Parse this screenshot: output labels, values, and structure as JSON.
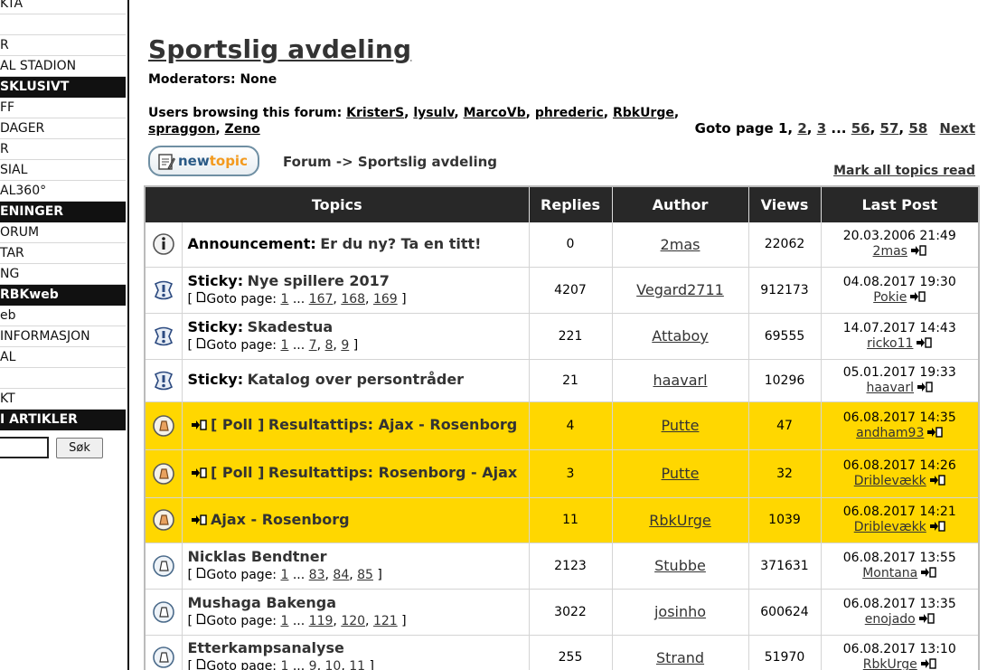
{
  "sidebar": {
    "items": [
      {
        "label": "KTA",
        "header": false
      },
      {
        "label": "",
        "header": false
      },
      {
        "label": "R",
        "header": false
      },
      {
        "label": "AL STADION",
        "header": false
      },
      {
        "label": "SKLUSIVT",
        "header": true
      },
      {
        "label": "FF",
        "header": false
      },
      {
        "label": "DAGER",
        "header": false
      },
      {
        "label": "R",
        "header": false
      },
      {
        "label": "SIAL",
        "header": false
      },
      {
        "label": "AL360°",
        "header": false
      },
      {
        "label": "ENINGER",
        "header": true
      },
      {
        "label": "ORUM",
        "header": false
      },
      {
        "label": "TAR",
        "header": false
      },
      {
        "label": "NG",
        "header": false
      },
      {
        "label": "RBKweb",
        "header": true
      },
      {
        "label": "eb",
        "header": false
      },
      {
        "label": " INFORMASJON",
        "header": false
      },
      {
        "label": "AL",
        "header": false
      },
      {
        "label": "",
        "header": false
      },
      {
        "label": "KT",
        "header": false
      },
      {
        "label": "I ARTIKLER",
        "header": true
      }
    ],
    "search_button": "Søk",
    "search_value": ""
  },
  "forum": {
    "title": "Sportslig avdeling",
    "moderators": "Moderators: None",
    "users_label": "Users browsing this forum:",
    "users": [
      "KristerS",
      "lysulv",
      "MarcoVb",
      "phrederic",
      "RbkUrge",
      "spraggon",
      "Zeno"
    ],
    "goto_label": "Goto page",
    "current_page": "1",
    "pages_start": [
      "2",
      "3"
    ],
    "ellipsis": "...",
    "pages_end": [
      "56",
      "57",
      "58"
    ],
    "next": "Next",
    "new_topic_a": "new",
    "new_topic_b": "topic",
    "breadcrumb_home": "Forum",
    "breadcrumb_sep": "->",
    "breadcrumb_current": "Sportslig avdeling",
    "mark_read": "Mark all topics read"
  },
  "table": {
    "headers": [
      "Topics",
      "Replies",
      "Author",
      "Views",
      "Last Post"
    ],
    "goto_page_label": "Goto page:",
    "rows": [
      {
        "type": "announcement",
        "kind": "Announcement:",
        "title": "Er du ny? Ta en titt!",
        "pages": null,
        "replies": "0",
        "author": "2mas",
        "views": "22062",
        "last_date": "20.03.2006 21:49",
        "last_user": "2mas",
        "hot": false
      },
      {
        "type": "sticky",
        "kind": "Sticky:",
        "title": "Nye spillere 2017",
        "pages": [
          "1",
          "167",
          "168",
          "169"
        ],
        "replies": "4207",
        "author": "Vegard2711",
        "views": "912173",
        "last_date": "04.08.2017 19:30",
        "last_user": "Pokie",
        "hot": false
      },
      {
        "type": "sticky",
        "kind": "Sticky:",
        "title": "Skadestua",
        "pages": [
          "1",
          "7",
          "8",
          "9"
        ],
        "replies": "221",
        "author": "Attaboy",
        "views": "69555",
        "last_date": "14.07.2017 14:43",
        "last_user": "ricko11",
        "hot": false
      },
      {
        "type": "sticky",
        "kind": "Sticky:",
        "title": "Katalog over persontråder",
        "pages": null,
        "replies": "21",
        "author": "haavarl",
        "views": "10296",
        "last_date": "05.01.2017 19:33",
        "last_user": "haavarl",
        "hot": false
      },
      {
        "type": "poll",
        "kind": "[ Poll ]",
        "title": "Resultattips: Ajax - Rosenborg",
        "pages": null,
        "replies": "4",
        "author": "Putte",
        "views": "47",
        "last_date": "06.08.2017 14:35",
        "last_user": "andham93",
        "hot": true
      },
      {
        "type": "poll",
        "kind": "[ Poll ]",
        "title": "Resultattips: Rosenborg - Ajax",
        "pages": null,
        "replies": "3",
        "author": "Putte",
        "views": "32",
        "last_date": "06.08.2017 14:26",
        "last_user": "Driblevækk",
        "hot": true
      },
      {
        "type": "new",
        "kind": "",
        "title": "Ajax - Rosenborg",
        "pages": null,
        "replies": "11",
        "author": "RbkUrge",
        "views": "1039",
        "last_date": "06.08.2017 14:21",
        "last_user": "Driblevækk",
        "hot": true
      },
      {
        "type": "normal",
        "kind": "",
        "title": "Nicklas Bendtner",
        "pages": [
          "1",
          "83",
          "84",
          "85"
        ],
        "replies": "2123",
        "author": "Stubbe",
        "views": "371631",
        "last_date": "06.08.2017 13:55",
        "last_user": "Montana",
        "hot": false
      },
      {
        "type": "normal",
        "kind": "",
        "title": "Mushaga Bakenga",
        "pages": [
          "1",
          "119",
          "120",
          "121"
        ],
        "replies": "3022",
        "author": "josinho",
        "views": "600624",
        "last_date": "06.08.2017 13:35",
        "last_user": "enojado",
        "hot": false
      },
      {
        "type": "normal",
        "kind": "",
        "title": "Etterkampsanalyse",
        "pages": [
          "1",
          "9",
          "10",
          "11"
        ],
        "replies": "255",
        "author": "Strand",
        "views": "51970",
        "last_date": "06.08.2017 13:10",
        "last_user": "RbkUrge",
        "hot": false
      }
    ]
  },
  "colors": {
    "hot_row": "#ffd700",
    "header_bg": "#282828",
    "link": "#333333"
  }
}
